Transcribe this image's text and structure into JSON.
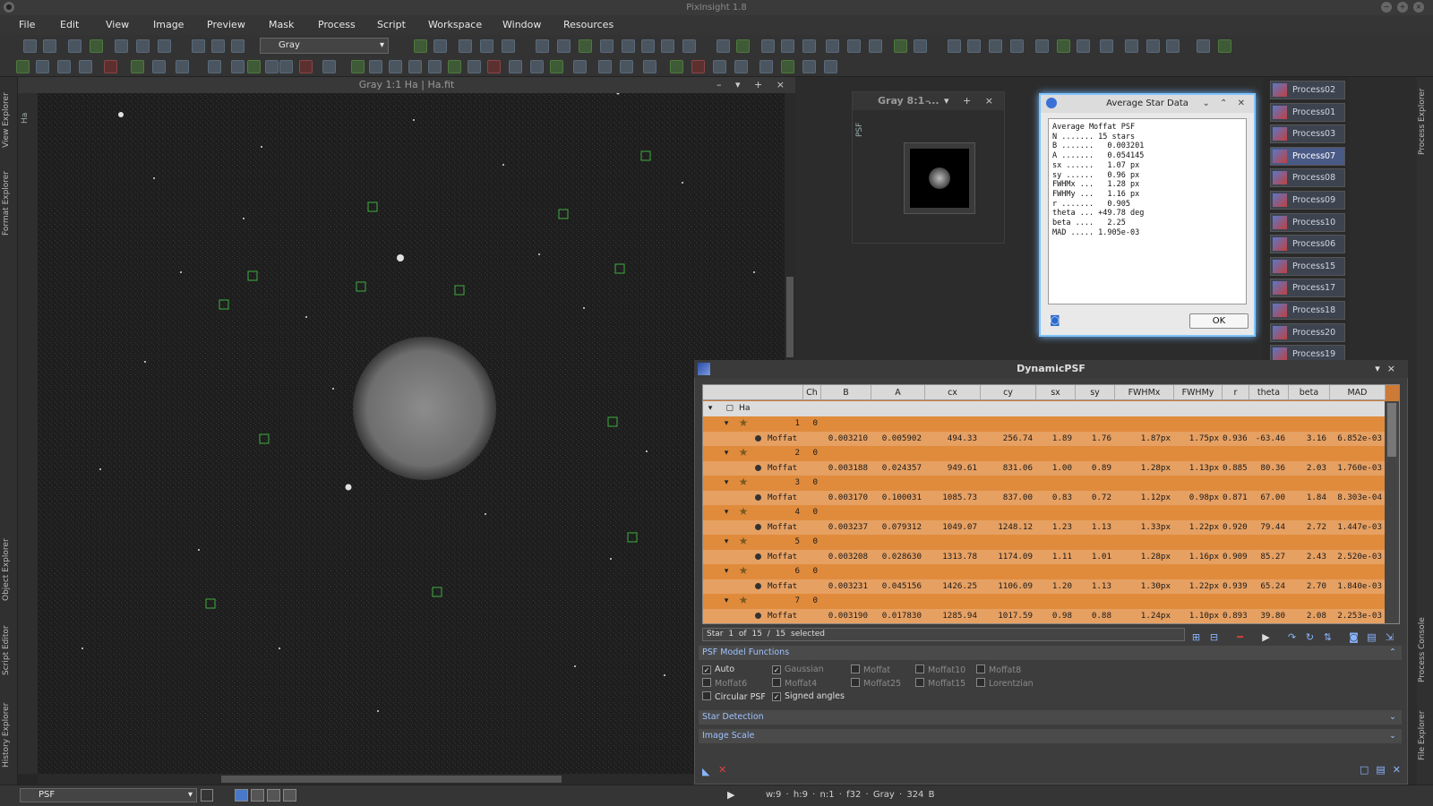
{
  "app": {
    "title": "PixInsight 1.8"
  },
  "menu": [
    "File",
    "Edit",
    "View",
    "Image",
    "Preview",
    "Mask",
    "Process",
    "Script",
    "Workspace",
    "Window",
    "Resources"
  ],
  "toolbar": {
    "view_selector": "Gray"
  },
  "left_rail": [
    "View Explorer",
    "Format Explorer",
    "Object Explorer",
    "Script Editor",
    "History Explorer"
  ],
  "right_rail": [
    "Process Explorer",
    "Process Console",
    "File Explorer"
  ],
  "image_window": {
    "title": "Gray 1:1 Ha | Ha.fit",
    "side_tab": "Ha"
  },
  "preview_window": {
    "title": "Gray 8:1 ...",
    "side_tab": "PSF"
  },
  "average_star_data": {
    "title": "Average Star Data",
    "text": "Average Moffat PSF\nN ....... 15 stars\nB .......   0.003201\nA .......   0.054145\nsx ......   1.07 px\nsy ......   0.96 px\nFWHMx ...   1.28 px\nFWHMy ...   1.16 px\nr .......   0.905\ntheta ... +49.78 deg\nbeta ....   2.25\nMAD ..... 1.905e-03",
    "ok_label": "OK"
  },
  "process_icons": [
    "Process02",
    "Process01",
    "Process03",
    "Process07",
    "Process08",
    "Process09",
    "Process10",
    "Process06",
    "Process15",
    "Process17",
    "Process18",
    "Process20",
    "Process19"
  ],
  "process_icons_selected": "Process07",
  "dynamic_psf": {
    "title": "DynamicPSF",
    "columns": [
      "",
      "Ch",
      "B",
      "A",
      "cx",
      "cy",
      "sx",
      "sy",
      "FWHMx",
      "FWHMy",
      "r",
      "theta",
      "beta",
      "MAD"
    ],
    "view_row": "Ha",
    "stars": [
      {
        "id": "1",
        "ch": "0",
        "fn": "Moffat",
        "B": "0.003210",
        "A": "0.005902",
        "cx": "494.33",
        "cy": "256.74",
        "sx": "1.89",
        "sy": "1.76",
        "fwhmx": "1.87px",
        "fwhmy": "1.75px",
        "r": "0.936",
        "theta": "-63.46",
        "beta": "3.16",
        "mad": "6.852e-03"
      },
      {
        "id": "2",
        "ch": "0",
        "fn": "Moffat",
        "B": "0.003188",
        "A": "0.024357",
        "cx": "949.61",
        "cy": "831.06",
        "sx": "1.00",
        "sy": "0.89",
        "fwhmx": "1.28px",
        "fwhmy": "1.13px",
        "r": "0.885",
        "theta": "80.36",
        "beta": "2.03",
        "mad": "1.760e-03"
      },
      {
        "id": "3",
        "ch": "0",
        "fn": "Moffat",
        "B": "0.003170",
        "A": "0.100031",
        "cx": "1085.73",
        "cy": "837.00",
        "sx": "0.83",
        "sy": "0.72",
        "fwhmx": "1.12px",
        "fwhmy": "0.98px",
        "r": "0.871",
        "theta": "67.00",
        "beta": "1.84",
        "mad": "8.303e-04"
      },
      {
        "id": "4",
        "ch": "0",
        "fn": "Moffat",
        "B": "0.003237",
        "A": "0.079312",
        "cx": "1049.07",
        "cy": "1248.12",
        "sx": "1.23",
        "sy": "1.13",
        "fwhmx": "1.33px",
        "fwhmy": "1.22px",
        "r": "0.920",
        "theta": "79.44",
        "beta": "2.72",
        "mad": "1.447e-03"
      },
      {
        "id": "5",
        "ch": "0",
        "fn": "Moffat",
        "B": "0.003208",
        "A": "0.028630",
        "cx": "1313.78",
        "cy": "1174.09",
        "sx": "1.11",
        "sy": "1.01",
        "fwhmx": "1.28px",
        "fwhmy": "1.16px",
        "r": "0.909",
        "theta": "85.27",
        "beta": "2.43",
        "mad": "2.520e-03"
      },
      {
        "id": "6",
        "ch": "0",
        "fn": "Moffat",
        "B": "0.003231",
        "A": "0.045156",
        "cx": "1426.25",
        "cy": "1106.09",
        "sx": "1.20",
        "sy": "1.13",
        "fwhmx": "1.30px",
        "fwhmy": "1.22px",
        "r": "0.939",
        "theta": "65.24",
        "beta": "2.70",
        "mad": "1.840e-03"
      },
      {
        "id": "7",
        "ch": "0",
        "fn": "Moffat",
        "B": "0.003190",
        "A": "0.017830",
        "cx": "1285.94",
        "cy": "1017.59",
        "sx": "0.98",
        "sy": "0.88",
        "fwhmx": "1.24px",
        "fwhmy": "1.10px",
        "r": "0.893",
        "theta": "39.80",
        "beta": "2.08",
        "mad": "2.253e-03"
      }
    ],
    "status": {
      "label": "Star",
      "index": "1 of",
      "selected": "15 / 15 selected"
    },
    "sections": {
      "psf_model": "PSF Model Functions",
      "star_detection": "Star Detection",
      "image_scale": "Image Scale"
    },
    "psf_options": [
      {
        "label": "Auto",
        "checked": true,
        "enabled": true
      },
      {
        "label": "Gaussian",
        "checked": true,
        "enabled": false
      },
      {
        "label": "Moffat",
        "checked": false,
        "enabled": false
      },
      {
        "label": "Moffat10",
        "checked": false,
        "enabled": false
      },
      {
        "label": "Moffat8",
        "checked": false,
        "enabled": false
      },
      {
        "label": "Moffat6",
        "checked": false,
        "enabled": false
      },
      {
        "label": "Moffat4",
        "checked": false,
        "enabled": false
      },
      {
        "label": "Moffat25",
        "checked": false,
        "enabled": false
      },
      {
        "label": "Moffat15",
        "checked": false,
        "enabled": false
      },
      {
        "label": "Lorentzian",
        "checked": false,
        "enabled": false
      },
      {
        "label": "Circular PSF",
        "checked": false,
        "enabled": true
      },
      {
        "label": "Signed angles",
        "checked": true,
        "enabled": true
      }
    ]
  },
  "bottom": {
    "view_combo": "PSF",
    "status": "w:9 · h:9 · n:1 · f32 · Gray · 324 B"
  },
  "colors": {
    "table_star": "#e08b3c",
    "table_psf": "#e6a062",
    "accent": "#7fc4ff"
  }
}
